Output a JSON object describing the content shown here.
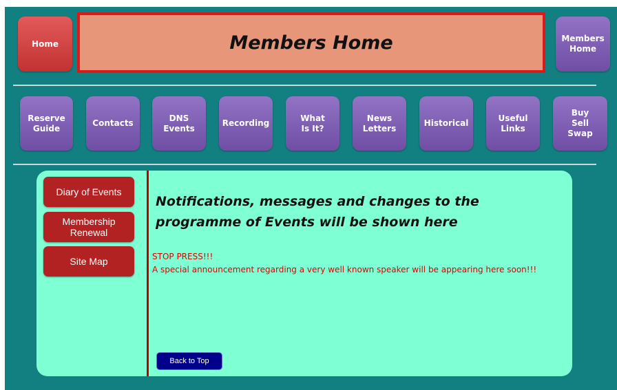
{
  "header": {
    "home_label": "Home",
    "banner_title": "Members Home",
    "members_home_label": "Members\nHome"
  },
  "nav": {
    "items": [
      {
        "label": "Reserve\nGuide"
      },
      {
        "label": "Contacts"
      },
      {
        "label": "DNS\nEvents"
      },
      {
        "label": "Recording"
      },
      {
        "label": "What\nIs It?"
      },
      {
        "label": "News\nLetters"
      },
      {
        "label": "Historical"
      },
      {
        "label": "Useful\nLinks"
      },
      {
        "label": "Buy\nSell\nSwap"
      }
    ]
  },
  "sidebar": {
    "items": [
      {
        "label": "Diary of Events"
      },
      {
        "label": "Membership\nRenewal"
      },
      {
        "label": "Site Map"
      }
    ]
  },
  "main": {
    "notice_heading": "Notifications, messages and changes to the programme of Events will be shown here",
    "stop_press_title": "STOP PRESS!!!",
    "stop_press_body": "A special announcement regarding a very well known speaker will be appearing here soon!!!",
    "back_to_top_label": "Back to Top"
  },
  "colors": {
    "page_bg": "#128080",
    "banner_bg": "#e8967a",
    "banner_border": "#d81a1a",
    "nav_button": "#7d5cb4",
    "panel_bg": "#7fffd4",
    "sidebar_button": "#b22222",
    "stop_press_text": "#e00000",
    "back_button": "#00008b"
  }
}
